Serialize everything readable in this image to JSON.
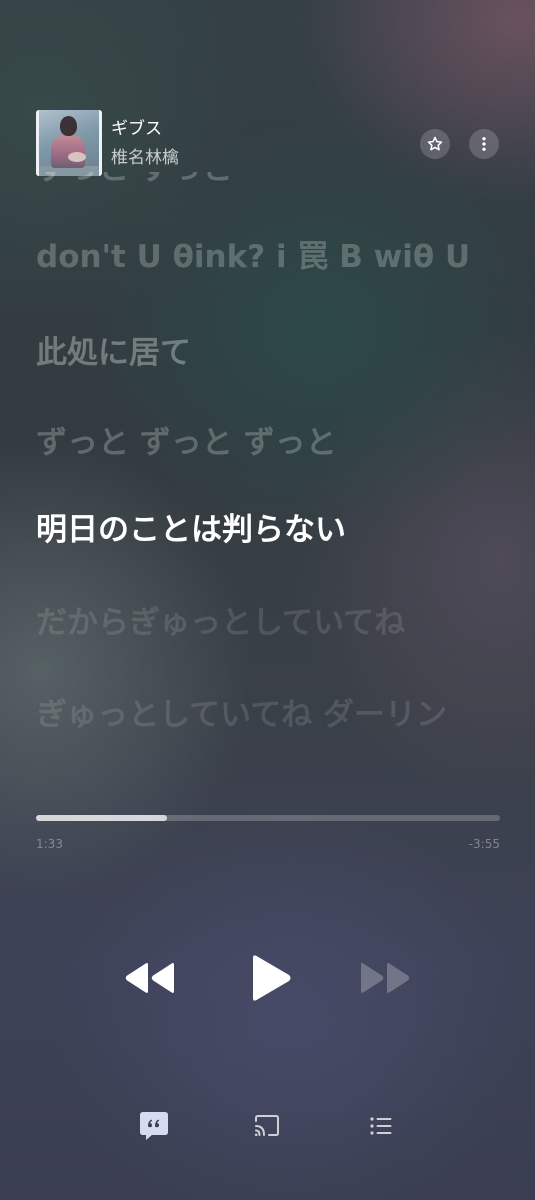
{
  "colors": {
    "accent": "#ffffff",
    "lyrics_active": "#ffffff",
    "lyrics_inactive": "rgba(255,255,255,0.25)",
    "lyrics_button_bg": "#d6dcef",
    "lyrics_button_glyph": "#3a3f55"
  },
  "now_playing": {
    "title": "ギブス",
    "artist": "椎名林檎",
    "album_art_icon": "album-art"
  },
  "header_actions": {
    "favorite_icon": "star-outline-icon",
    "more_icon": "more-vertical-icon"
  },
  "lyrics": {
    "lines": [
      {
        "text": "ずっと ずっと",
        "state": "partial"
      },
      {
        "text": "don't U θink? i 罠 B wiθ U",
        "state": "inactive"
      },
      {
        "text": "此処に居て",
        "state": "inactive"
      },
      {
        "text": "ずっと ずっと ずっと",
        "state": "inactive"
      },
      {
        "text": "明日のことは判らない",
        "state": "active"
      },
      {
        "text": "だからぎゅっとしていてね",
        "state": "inactive"
      },
      {
        "text": "ぎゅっとしていてね ダーリン",
        "state": "inactive"
      }
    ]
  },
  "playback": {
    "elapsed": "1:33",
    "remaining": "-3:55",
    "progress": 0.283
  },
  "controls": {
    "rewind_icon": "rewind-icon",
    "play_icon": "play-icon",
    "fast_forward_icon": "fast-forward-icon",
    "fast_forward_enabled": false
  },
  "toolbar": {
    "lyrics_icon": "lyrics-quote-icon",
    "lyrics_active": true,
    "cast_icon": "cast-icon",
    "queue_icon": "queue-list-icon"
  }
}
